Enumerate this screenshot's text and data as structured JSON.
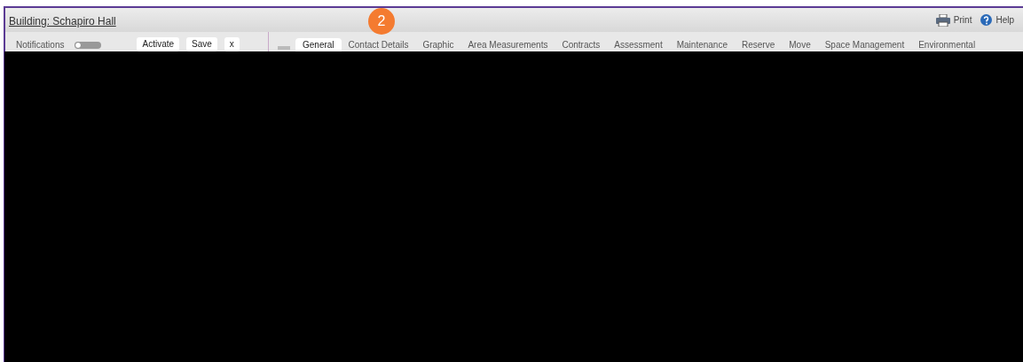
{
  "window": {
    "title": "Building: Schapiro Hall"
  },
  "toolbar": [
    {
      "kind": "print",
      "label": "Print"
    },
    {
      "kind": "help",
      "label": "Help"
    }
  ],
  "left_panel": {
    "label": "Notifications",
    "notifications_on": false,
    "buttons": [
      "Activate",
      "Save",
      "x"
    ]
  },
  "tabs": [
    {
      "label": "General",
      "selected": true
    },
    {
      "label": "Contact Details",
      "selected": false
    },
    {
      "label": "Graphic",
      "selected": false
    },
    {
      "label": "Area Measurements",
      "selected": false
    },
    {
      "label": "Contracts",
      "selected": false
    },
    {
      "label": "Assessment",
      "selected": false
    },
    {
      "label": "Maintenance",
      "selected": false
    },
    {
      "label": "Reserve",
      "selected": false
    },
    {
      "label": "Move",
      "selected": false
    },
    {
      "label": "Space Management",
      "selected": false
    },
    {
      "label": "Environmental",
      "selected": false
    }
  ],
  "step_badge": "2"
}
